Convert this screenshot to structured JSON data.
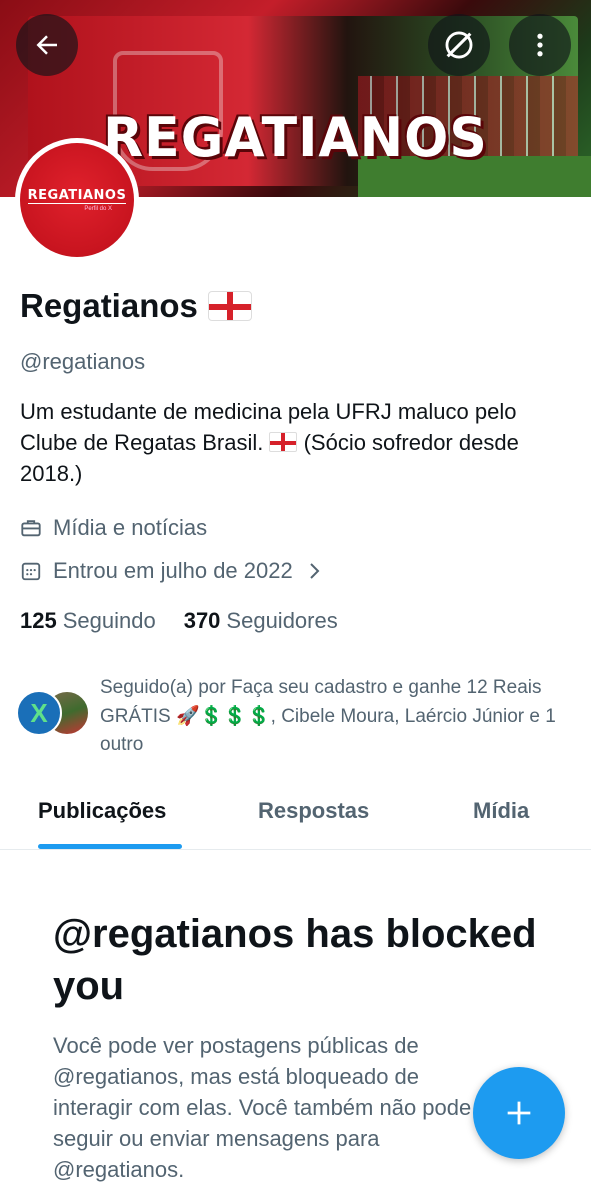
{
  "banner": {
    "title": "REGATIANOS"
  },
  "header": {
    "back_icon": "arrow-left-icon",
    "block_icon": "blocked-icon",
    "more_icon": "more-vertical-icon"
  },
  "avatar": {
    "text": "REGATIANOS",
    "subtext": "Perfil do X"
  },
  "profile": {
    "name": "Regatianos",
    "handle": "@regatianos",
    "bio_part1": "Um estudante de medicina pela UFRJ maluco pelo Clube de Regatas Brasil. ",
    "bio_part2": " (Sócio sofredor desde 2018.)",
    "category": "Mídia e notícias",
    "joined": "Entrou em julho de 2022",
    "following_count": "125",
    "following_label": "Seguindo",
    "followers_count": "370",
    "followers_label": "Seguidores"
  },
  "followed_by": {
    "text": "Seguido(a) por Faça seu cadastro e ganhe 12 Reais GRÁTIS 🚀💲💲💲, Cibele Moura, Laércio Júnior e 1 outro",
    "avatar1_letter": "X"
  },
  "tabs": [
    {
      "label": "Publicações",
      "active": true
    },
    {
      "label": "Respostas",
      "active": false
    },
    {
      "label": "Mídia",
      "active": false
    }
  ],
  "blocked": {
    "title": "@regatianos has blocked you",
    "body": "Você pode ver postagens públicas de @regatianos, mas está bloqueado de interagir com elas. Você também não pode seguir ou enviar mensagens para @regatianos."
  },
  "fab": {
    "icon": "plus-icon"
  },
  "colors": {
    "accent": "#1d9bf0",
    "text": "#0f1419",
    "secondary": "#536471",
    "banner_red": "#c41e2a"
  }
}
